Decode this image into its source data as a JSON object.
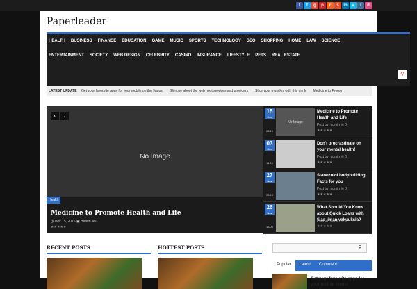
{
  "social": [
    {
      "icon": "facebook-icon",
      "glyph": "f",
      "color": "#3b5998"
    },
    {
      "icon": "twitter-icon",
      "glyph": "t",
      "color": "#1da1f2"
    },
    {
      "icon": "google-plus-icon",
      "glyph": "g",
      "color": "#dd4b39"
    },
    {
      "icon": "pinterest-icon",
      "glyph": "p",
      "color": "#cb2027"
    },
    {
      "icon": "rss-icon",
      "glyph": "r",
      "color": "#f26522"
    },
    {
      "icon": "stumble-icon",
      "glyph": "s",
      "color": "#eb4924"
    },
    {
      "icon": "linkedin-icon",
      "glyph": "in",
      "color": "#0077b5"
    },
    {
      "icon": "vimeo-icon",
      "glyph": "v",
      "color": "#1ab7ea"
    },
    {
      "icon": "instagram-icon",
      "glyph": "i",
      "color": "#3f729b"
    },
    {
      "icon": "dribbble-icon",
      "glyph": "d",
      "color": "#ea4c89"
    }
  ],
  "site": {
    "logo": "Paperleader"
  },
  "nav": {
    "row1": [
      "HEALTH",
      "BUSINESS",
      "FINANCE",
      "EDUCATION",
      "GAME",
      "MUSIC",
      "SPORTS",
      "TECHNOLOGY",
      "SEO",
      "SHOPPING",
      "HOME",
      "LAW",
      "SCIENCE"
    ],
    "row2": [
      "ENTERTAINMENT",
      "SOCIETY",
      "WEB DESIGN",
      "CELEBRITY",
      "CASINO",
      "INSURANCE",
      "LIFESTYLE",
      "PETS",
      "REAL ESTATE"
    ]
  },
  "ticker": {
    "label": "LATEST UPDATE",
    "items": [
      "Get your favourite apps for your mobile on the 9apps",
      "Glimpse about the web host services and providers",
      "Slice your muscles with this drink",
      "Medicine to Promo"
    ]
  },
  "slider": {
    "no_image": "No Image",
    "category": "Health",
    "title": "Medicine to Promote Health and Life",
    "date": "Dec 15, 2015",
    "cat_meta": "Health",
    "comments": "0",
    "prev": "‹",
    "next": "›"
  },
  "side_posts": [
    {
      "day": "15",
      "month": "Dec",
      "time": "05:19",
      "thumb": "No Image",
      "title": "Medicine to Promote Health and Life",
      "meta": "Post by: admin",
      "comments": "0"
    },
    {
      "day": "03",
      "month": "Dec",
      "time": "11:20",
      "thumb": "",
      "title": "Don't procrastinate on your mental health!",
      "meta": "Post by: admin",
      "comments": "0"
    },
    {
      "day": "27",
      "month": "Nov",
      "time": "05:18",
      "thumb": "",
      "title": "Stanozolol bodybuilding Facts for you",
      "meta": "Post by: admin",
      "comments": "0"
    },
    {
      "day": "26",
      "month": "Nov",
      "time": "13:00",
      "thumb": "",
      "title": "What Should You Know about Quick Loans with tilaa liman vakuuksia?",
      "meta": "Post by: admin",
      "comments": "0"
    }
  ],
  "sections": {
    "recent": "RECENT POSTS",
    "hottest": "HOTTEST POSTS"
  },
  "sidebar": {
    "tabs": [
      "Popular",
      "Latest",
      "Comment"
    ],
    "popular_title": "Get your favourite apps for your mobile on the"
  },
  "colors": {
    "accent": "#2f6ec9"
  }
}
